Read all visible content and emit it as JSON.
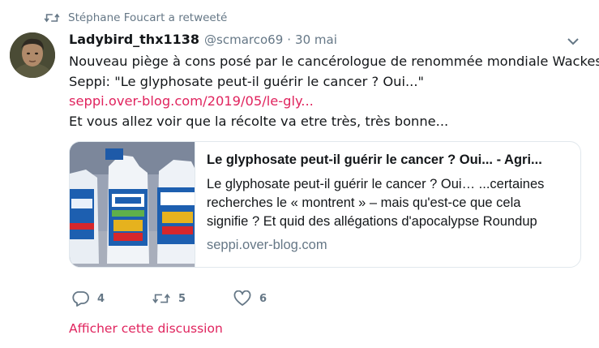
{
  "retweet": {
    "text": "Stéphane Foucart a retweeté"
  },
  "author": {
    "name": "Ladybird_thx1138",
    "handle": "@scmarco69",
    "separator": "·",
    "date": "30 mai"
  },
  "tweet": {
    "line1": "Nouveau piège à cons posé par le cancérologue de renommée mondiale Wackes",
    "line2": "Seppi: \"Le glyphosate peut-il guérir le cancer ? Oui...\"",
    "link": "seppi.over-blog.com/2019/05/le-gly...",
    "line3": "Et vous allez voir que la récolte va etre très, très bonne..."
  },
  "card": {
    "title": "Le glyphosate peut-il guérir le cancer ? Oui... - Agri...",
    "desc_line1": "Le glyphosate peut-il guérir le cancer ? Oui… ...certaines",
    "desc_line2": "recherches le « montrent » – mais qu'est-ce que cela",
    "desc_line3": "signifie ? Et quid des allégations d'apocalypse Roundup",
    "domain": "seppi.over-blog.com"
  },
  "actions": {
    "replies": "4",
    "retweets": "5",
    "likes": "6"
  },
  "show_thread": "Afficher cette discussion",
  "colors": {
    "accent": "#e0245e",
    "muted": "#657786",
    "text": "#14171a",
    "border": "#e1e8ed"
  },
  "icons": {
    "retweet": "retweet-icon",
    "caret": "chevron-down-icon",
    "reply": "reply-icon",
    "like": "heart-icon"
  }
}
